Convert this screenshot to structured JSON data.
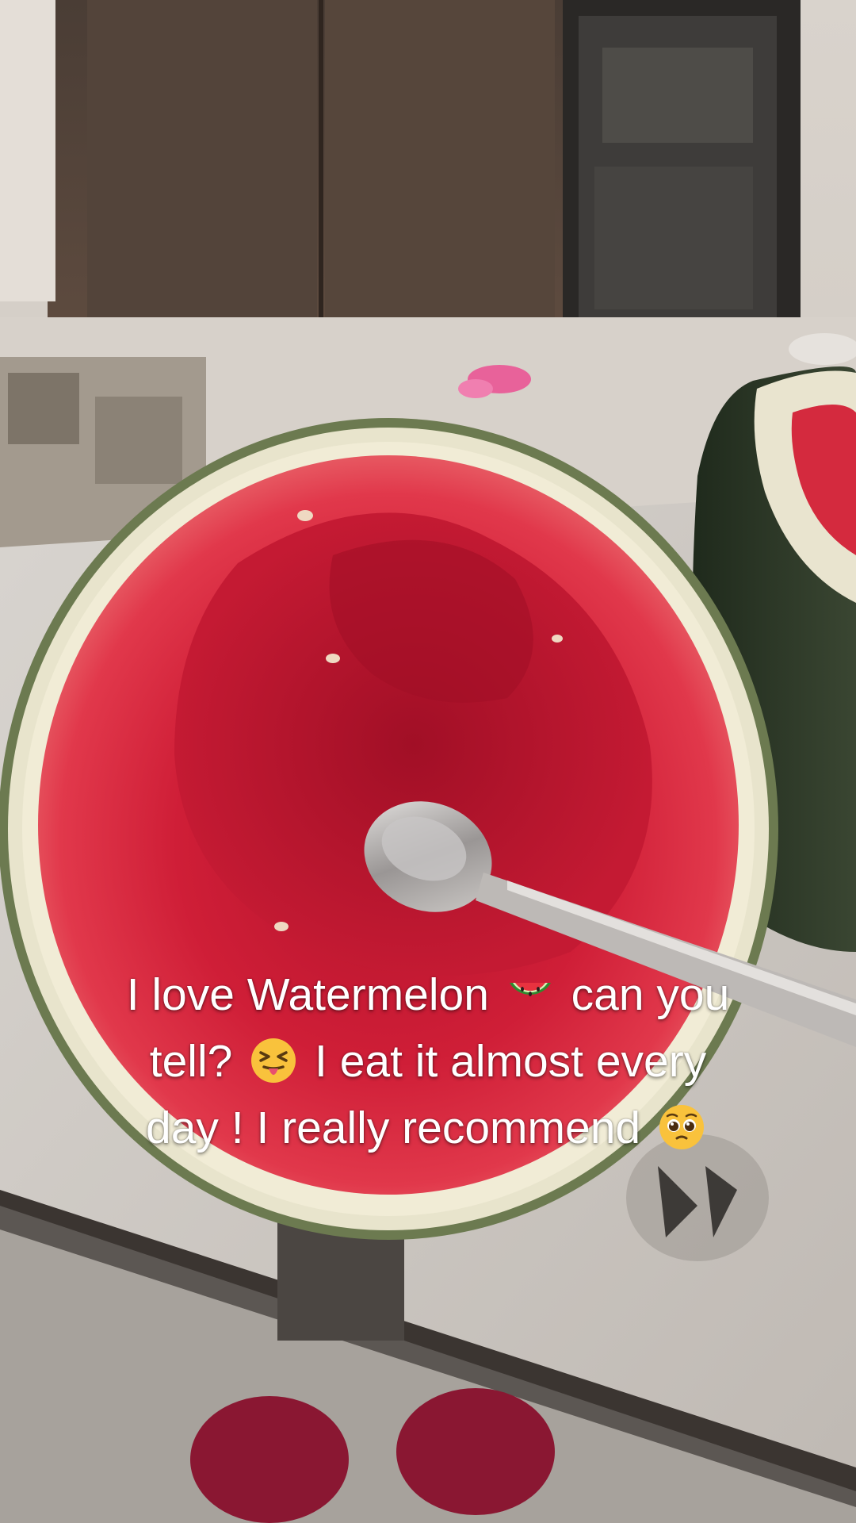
{
  "caption": {
    "line1_a": "I love Watermelon",
    "line1_b": "can you",
    "line2_a": "tell?",
    "line2_b": "I eat it almost every",
    "line3_a": "day ! I really recommend"
  },
  "emojis": [
    "watermelon-emoji",
    "squinting-face-with-tongue-emoji",
    "pleading-face-emoji"
  ],
  "colors": {
    "flesh": "#d8233a",
    "rind_light": "#e9e6cf",
    "rind_dark": "#3f4a34",
    "caption_text": "#ffffff"
  }
}
